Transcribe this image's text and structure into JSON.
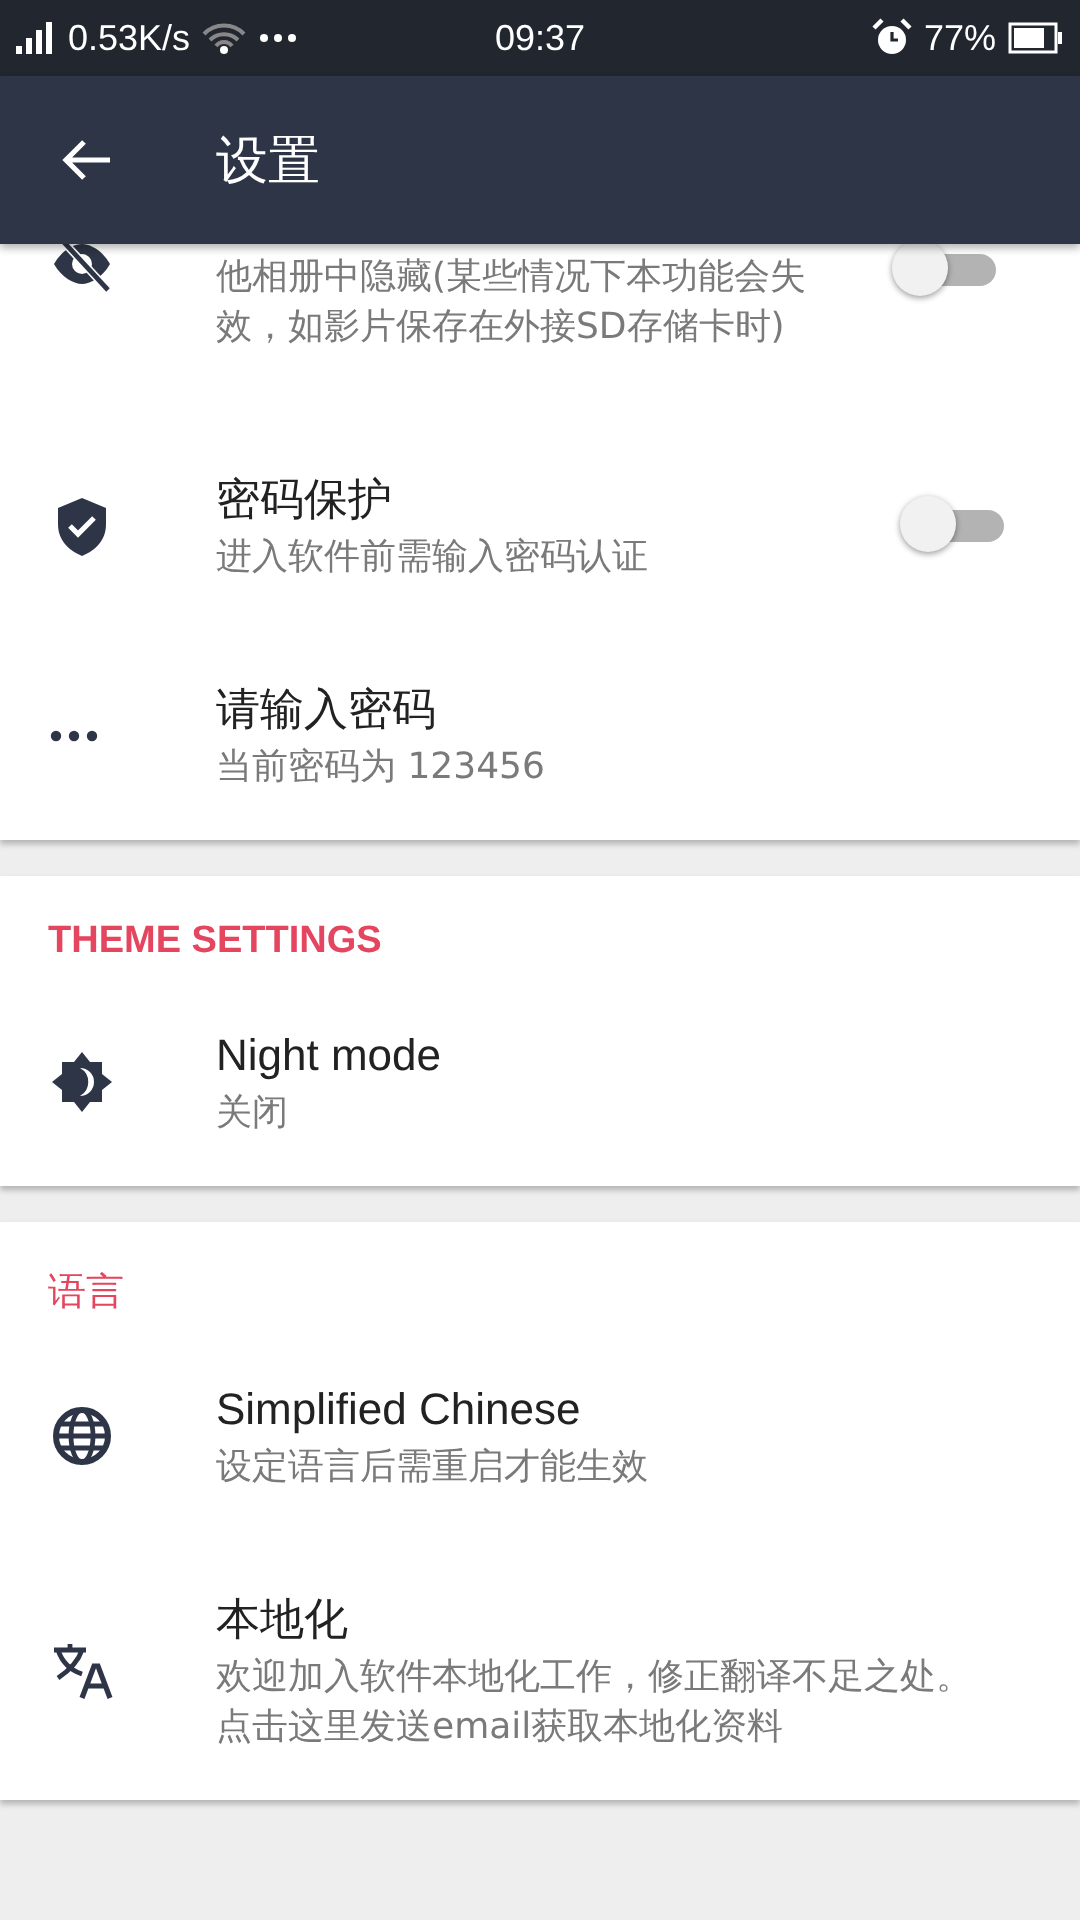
{
  "status_bar": {
    "net_speed": "0.53K/s",
    "time": "09:37",
    "battery": "77%"
  },
  "app_bar": {
    "title": "设置"
  },
  "sections": [
    {
      "items": [
        {
          "kind": "toggle",
          "description": "他相册中隐藏(某些情况下本功能会失效，如影片保存在外接SD存储卡时)",
          "on": false
        },
        {
          "kind": "toggle",
          "title": "密码保护",
          "description": "进入软件前需输入密码认证",
          "on": false
        },
        {
          "kind": "plain",
          "title": "请输入密码",
          "description": "当前密码为 123456"
        }
      ]
    },
    {
      "header": "THEME SETTINGS",
      "header_bold": true,
      "items": [
        {
          "kind": "plain",
          "title": "Night mode",
          "description": "关闭"
        }
      ]
    },
    {
      "header": "语言",
      "header_bold": false,
      "items": [
        {
          "kind": "plain",
          "title": "Simplified Chinese",
          "description": "设定语言后需重启才能生效"
        },
        {
          "kind": "plain",
          "title": "本地化",
          "description": "欢迎加入软件本地化工作，修正翻译不足之处。点击这里发送email获取本地化资料"
        }
      ]
    }
  ]
}
